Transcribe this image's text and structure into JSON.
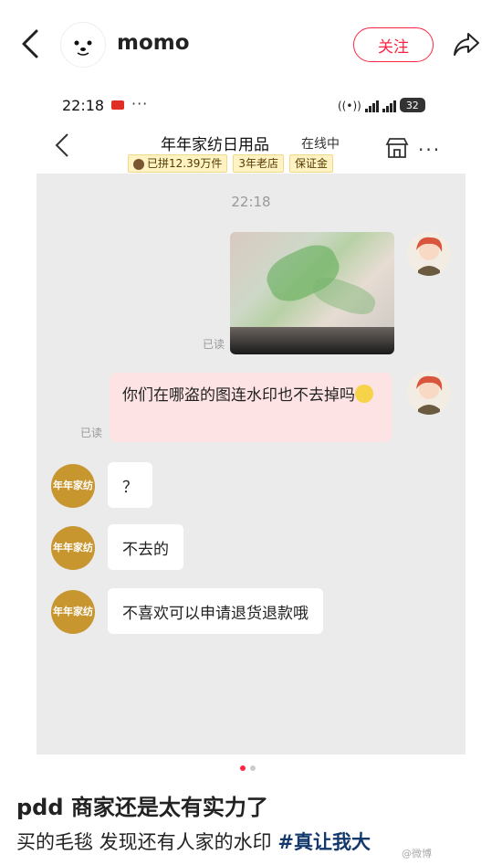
{
  "header": {
    "username": "momo",
    "follow_label": "关注"
  },
  "screenshot": {
    "status_bar": {
      "time": "22:18",
      "dots": "···",
      "battery": "32"
    },
    "chat_header": {
      "shop_name": "年年家纺日用品",
      "online_status": "在线中",
      "tags": [
        "已拼12.39万件",
        "3年老店",
        "保证金"
      ]
    },
    "chat": {
      "time": "22:18",
      "read_label": "已读",
      "my_message": "你们在哪盗的图连水印也不去掉吗",
      "shop_avatar_text": "年年家纺",
      "shop_messages": [
        "？",
        "不去的",
        "不喜欢可以申请退货退款哦"
      ]
    }
  },
  "post": {
    "title": "pdd 商家还是太有实力了",
    "description": "买的毛毯 发现还有人家的水印 ",
    "hashtag": "#真让我大",
    "watermark": "@微博"
  },
  "colors": {
    "accent": "#ff2442",
    "tag_bg": "#fff3c4",
    "bubble_pink": "#fde3e3",
    "shop_avatar": "#c8962f"
  }
}
